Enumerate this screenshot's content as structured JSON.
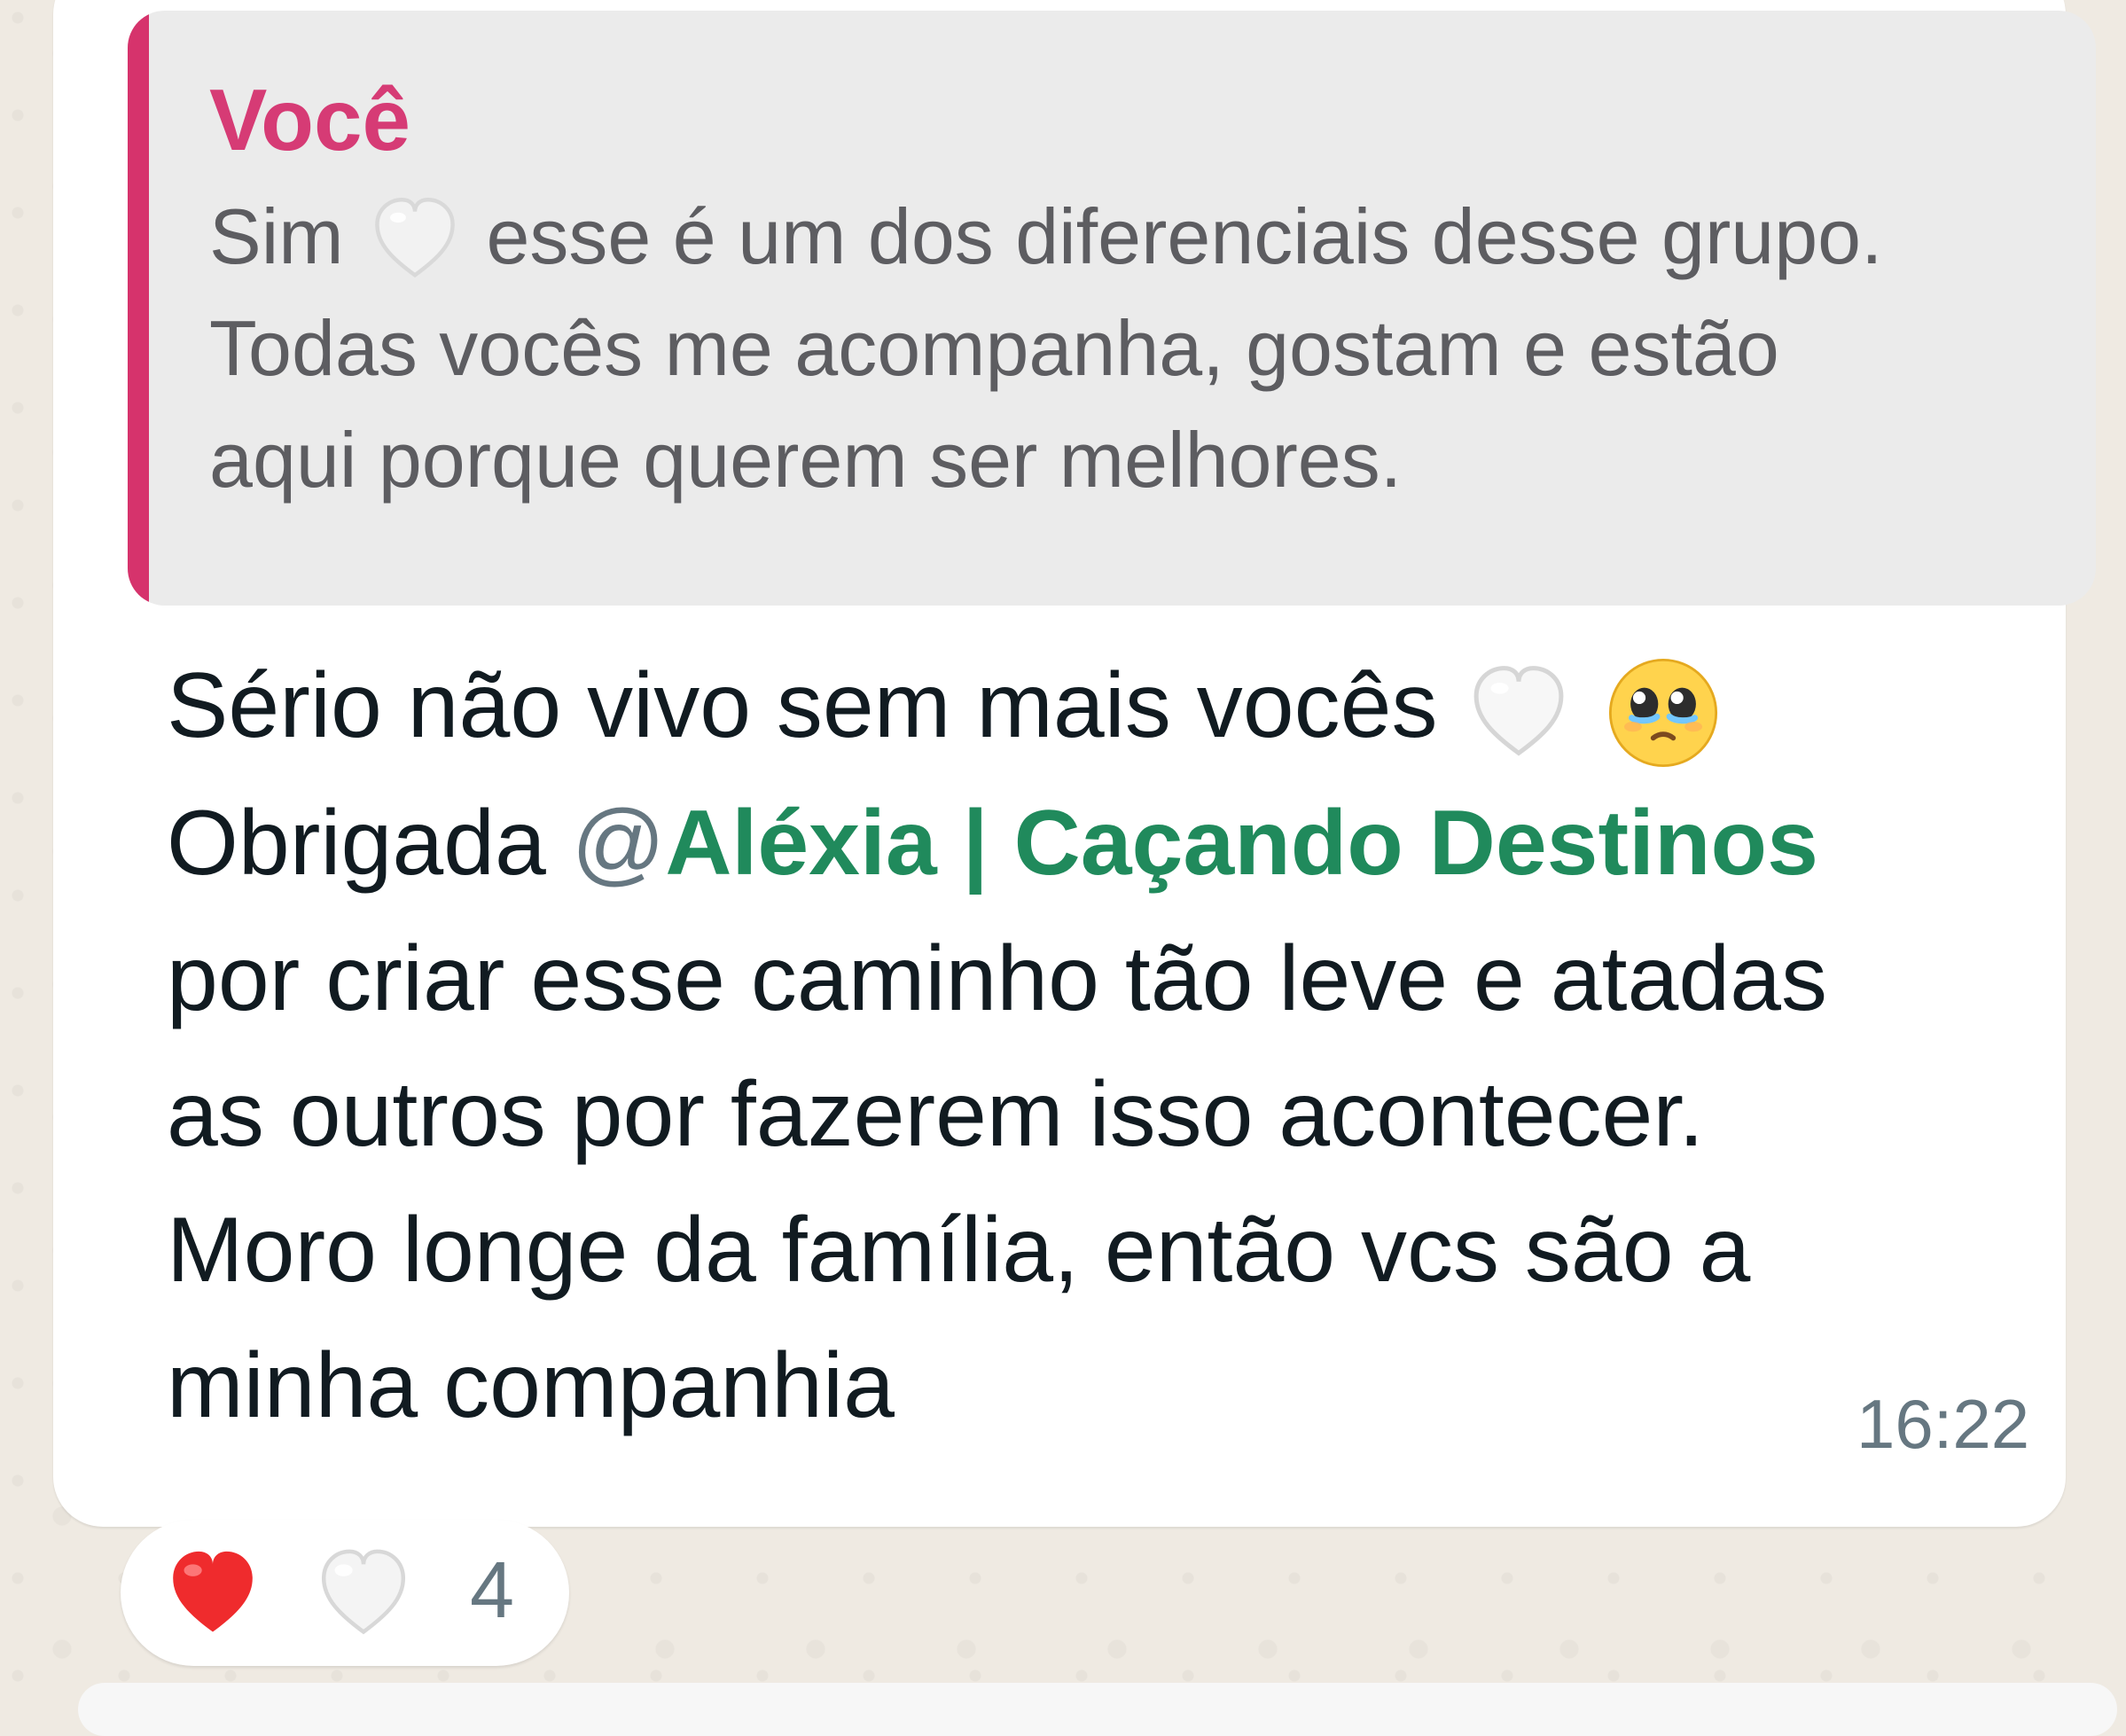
{
  "chat": {
    "quoted_message": {
      "author": "Você",
      "lines": [
        "Sim",
        "esse é um dos diferenciais desse grupo.",
        "Todas vocês me acompanha, gostam e estão",
        "aqui porque querem ser melhores."
      ]
    },
    "message": {
      "line_1": "Sério não vivo sem mais vocês",
      "line_2_prefix": "Obrigada ",
      "mention_at": "@",
      "mention_name": "Aléxia | Caçando Destinos",
      "line_3": "por criar esse caminho tão leve e atadas",
      "line_4": "as outros por fazerem isso acontecer.",
      "line_5": "Moro longe da família,  então vcs são a",
      "line_6": "minha companhia"
    },
    "timestamp": "16:22",
    "reactions": {
      "count": "4",
      "icons": [
        "red-heart-icon",
        "white-heart-icon"
      ]
    },
    "colors": {
      "chat_background": "#efeae2",
      "message_bubble": "#ffffff",
      "quote_background": "#ebebeb",
      "quote_bar": "#d6336c",
      "quote_author": "#d63b75",
      "mention_name": "#208a5c",
      "meta_text": "#667781"
    }
  }
}
